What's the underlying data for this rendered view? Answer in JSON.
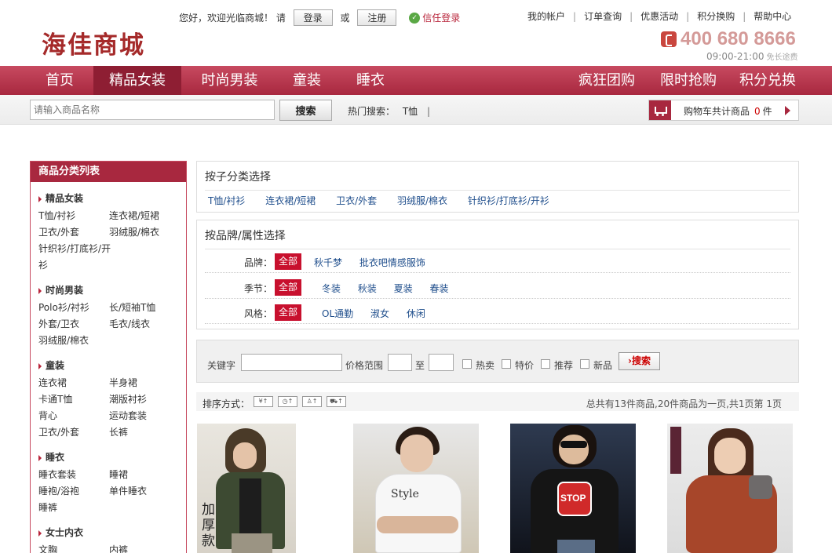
{
  "header": {
    "logo": "海佳商城",
    "welcome_text": "您好，欢迎光临商城！ 请",
    "login_label": "登录",
    "or_text": "或",
    "register_label": "注册",
    "trust_login_label": "信任登录",
    "top_links": [
      "我的帐户",
      "订单查询",
      "优惠活动",
      "积分换购",
      "帮助中心"
    ],
    "hotline": "400 680 8666",
    "hours": "09:00-21:00",
    "hours_note": "免长途费"
  },
  "nav": {
    "left_items": [
      "首页",
      "精品女装",
      "时尚男装",
      "童装",
      "睡衣"
    ],
    "active": "精品女装",
    "right_items": [
      "疯狂团购",
      "限时抢购",
      "积分兑换"
    ]
  },
  "search": {
    "placeholder": "请输入商品名称",
    "button_label": "搜索",
    "hot_label": "热门搜索：",
    "hot_terms": [
      "T恤"
    ],
    "hot_sep": "|"
  },
  "cart": {
    "label": "购物车共计商品",
    "count": "0",
    "unit": "件"
  },
  "sidebar": {
    "title": "商品分类列表",
    "categories": [
      {
        "title": "精品女装",
        "items": [
          "T恤/衬衫",
          "连衣裙/短裙",
          "卫衣/外套",
          "羽绒服/棉衣",
          "针织衫/打底衫/开衫"
        ]
      },
      {
        "title": "时尚男装",
        "items": [
          "Polo衫/衬衫",
          "长/短袖T恤",
          "外套/卫衣",
          "毛衣/线衣",
          "羽绒服/棉衣"
        ]
      },
      {
        "title": "童装",
        "items": [
          "连衣裙",
          "半身裙",
          "卡通T恤",
          "潮版衬衫",
          "背心",
          "运动套装",
          "卫衣/外套",
          "长裤"
        ]
      },
      {
        "title": "睡衣",
        "items": [
          "睡衣套装",
          "睡裙",
          "睡袍/浴袍",
          "单件睡衣",
          "睡裤"
        ]
      },
      {
        "title": "女士内衣",
        "items": [
          "文胸",
          "内裤"
        ]
      }
    ]
  },
  "subcategory_panel": {
    "title": "按子分类选择",
    "links": [
      "T恤/衬衫",
      "连衣裙/短裙",
      "卫衣/外套",
      "羽绒服/棉衣",
      "针织衫/打底衫/开衫"
    ]
  },
  "brand_panel": {
    "title": "按品牌/属性选择",
    "all_label": "全部",
    "rows": [
      {
        "label": "品牌：",
        "options": [
          "秋千梦",
          "批衣吧情感服饰"
        ]
      },
      {
        "label": "季节：",
        "options": [
          "冬装",
          "秋装",
          "夏装",
          "春装"
        ]
      },
      {
        "label": "风格：",
        "options": [
          "OL通勤",
          "淑女",
          "休闲"
        ]
      }
    ]
  },
  "filter_bar": {
    "keyword_label": "关键字",
    "price_label": "价格范围",
    "to_label": "至",
    "checkboxes": [
      "热卖",
      "特价",
      "推荐",
      "新品"
    ],
    "search_label": "搜索"
  },
  "sort": {
    "label": "排序方式：",
    "buttons": [
      "¥↑",
      "◷↑",
      "♙↑",
      "⛟↑"
    ],
    "summary": "总共有13件商品,20件商品为一页,共1页第  1页"
  },
  "products": [
    {
      "label": "加厚款",
      "icon": "hooded-jacket-photo"
    },
    {
      "label": "",
      "icon": "white-tee-photo"
    },
    {
      "label": "",
      "icon": "stop-tee-photo"
    },
    {
      "label": "",
      "icon": "knit-sweater-photo"
    }
  ],
  "colors": {
    "brand": "#a8283f",
    "accent_red": "#c8102e",
    "link_blue": "#1f4e8c"
  }
}
